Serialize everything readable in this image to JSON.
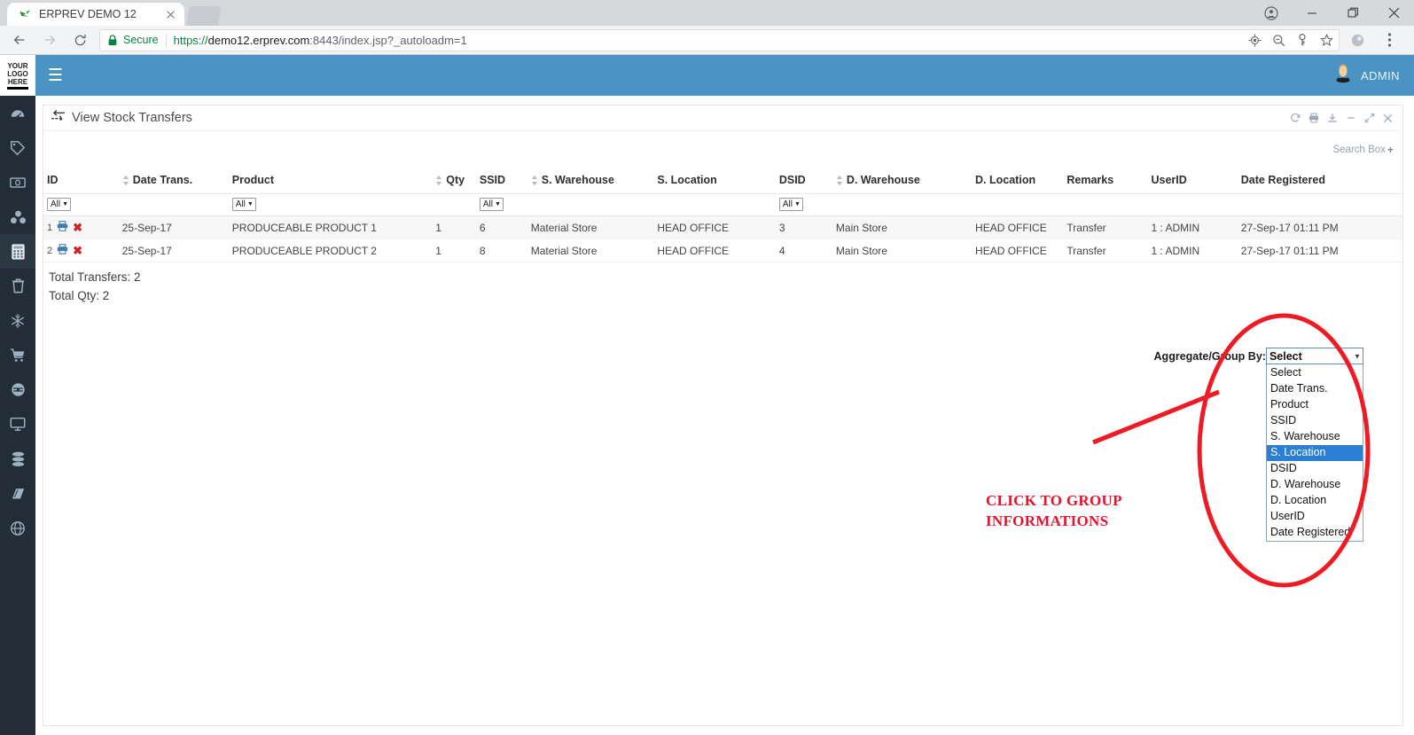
{
  "browser": {
    "tab": {
      "title": "ERPREV DEMO 12",
      "favicon_icon": "bird-logo-icon",
      "close_icon": "close-icon"
    },
    "new_tab_icon": "new-tab-icon",
    "window_controls": [
      {
        "name": "profile-icon",
        "glyph": "profile"
      },
      {
        "name": "minimize-button",
        "glyph": "minimize"
      },
      {
        "name": "maximize-button",
        "glyph": "maximize"
      },
      {
        "name": "close-window-button",
        "glyph": "close"
      }
    ],
    "nav": {
      "back_icon": "back-arrow-icon",
      "forward_icon": "forward-arrow-icon",
      "reload_icon": "reload-icon"
    },
    "omnibox": {
      "security_label": "Secure",
      "lock_icon": "lock-icon",
      "url_scheme": "https://",
      "url_host": "demo12.erprev.com",
      "url_rest": ":8443/index.jsp?_autoloadm=1",
      "full_url": "https://demo12.erprev.com:8443/index.jsp?_autoloadm=1",
      "icons": [
        "location-target-icon",
        "zoom-out-icon",
        "key-icon",
        "bookmark-star-icon"
      ]
    },
    "toolbar_right": [
      "browser-profile-avatar-icon",
      "chrome-menu-icon"
    ]
  },
  "sidebar": {
    "logo": {
      "line1": "YOUR",
      "line2": "LOGO",
      "line3": "HERE"
    },
    "items": [
      {
        "name": "dashboard",
        "icon": "gauge-icon",
        "active": false
      },
      {
        "name": "sales",
        "icon": "tag-icon",
        "active": false
      },
      {
        "name": "finance",
        "icon": "money-icon",
        "active": false
      },
      {
        "name": "inventory",
        "icon": "cubes-icon",
        "active": false
      },
      {
        "name": "stock",
        "icon": "calculator-icon",
        "active": true
      },
      {
        "name": "waste",
        "icon": "trash-icon",
        "active": false
      },
      {
        "name": "cold-storage",
        "icon": "snowflake-icon",
        "active": false
      },
      {
        "name": "purchase",
        "icon": "shopping-cart-icon",
        "active": false
      },
      {
        "name": "production",
        "icon": "disc-icon",
        "active": false
      },
      {
        "name": "pos",
        "icon": "monitor-icon",
        "active": false
      },
      {
        "name": "database",
        "icon": "database-icon",
        "active": false
      },
      {
        "name": "reports",
        "icon": "book-icon",
        "active": false
      },
      {
        "name": "settings",
        "icon": "globe-icon",
        "active": false
      }
    ]
  },
  "topbar": {
    "menu_toggle_icon": "hamburger-menu-icon",
    "user_icon": "user-avatar-icon",
    "user_label": "ADMIN",
    "background_color": "#4a94c4"
  },
  "panel": {
    "title": "View Stock Transfers",
    "title_icon": "exchange-arrows-icon",
    "tools": [
      {
        "name": "refresh-icon",
        "glyph": "refresh"
      },
      {
        "name": "print-icon",
        "glyph": "print"
      },
      {
        "name": "download-icon",
        "glyph": "download"
      },
      {
        "name": "minimize-panel-icon",
        "glyph": "minus"
      },
      {
        "name": "expand-panel-icon",
        "glyph": "expand"
      },
      {
        "name": "close-panel-icon",
        "glyph": "close"
      }
    ],
    "search_box_label": "Search Box",
    "search_box_plus": "+"
  },
  "table": {
    "columns": [
      {
        "label": "ID",
        "sortable": false,
        "filter": "All"
      },
      {
        "label": "Date Trans.",
        "sortable": true,
        "filter": null
      },
      {
        "label": "Product",
        "sortable": false,
        "filter": "All"
      },
      {
        "label": "Qty",
        "sortable": true,
        "filter": null
      },
      {
        "label": "SSID",
        "sortable": false,
        "filter": "All"
      },
      {
        "label": "S. Warehouse",
        "sortable": true,
        "filter": null
      },
      {
        "label": "S. Location",
        "sortable": false,
        "filter": null
      },
      {
        "label": "DSID",
        "sortable": false,
        "filter": "All"
      },
      {
        "label": "D. Warehouse",
        "sortable": true,
        "filter": null
      },
      {
        "label": "D. Location",
        "sortable": false,
        "filter": null
      },
      {
        "label": "Remarks",
        "sortable": false,
        "filter": null
      },
      {
        "label": "UserID",
        "sortable": false,
        "filter": null
      },
      {
        "label": "Date Registered",
        "sortable": false,
        "filter": null
      }
    ],
    "rows": [
      {
        "id": "1",
        "date_trans": "25-Sep-17",
        "product": "PRODUCEABLE PRODUCT 1",
        "qty": "1",
        "ssid": "6",
        "s_warehouse": "Material Store",
        "s_location": "HEAD OFFICE",
        "dsid": "3",
        "d_warehouse": "Main Store",
        "d_location": "HEAD OFFICE",
        "remarks": "Transfer",
        "userid": "1 : ADMIN",
        "date_registered": "27-Sep-17 01:11 PM"
      },
      {
        "id": "2",
        "date_trans": "25-Sep-17",
        "product": "PRODUCEABLE PRODUCT 2",
        "qty": "1",
        "ssid": "8",
        "s_warehouse": "Material Store",
        "s_location": "HEAD OFFICE",
        "dsid": "4",
        "d_warehouse": "Main Store",
        "d_location": "HEAD OFFICE",
        "remarks": "Transfer",
        "userid": "1 : ADMIN",
        "date_registered": "27-Sep-17 01:11 PM"
      }
    ],
    "row_print_icon": "print-row-icon",
    "row_delete_icon": "delete-row-icon",
    "totals": {
      "transfers": "Total Transfers: 2",
      "qty": "Total Qty: 2"
    }
  },
  "aggregate": {
    "label": "Aggregate/Group By:",
    "selected": "Select",
    "options": [
      "Select",
      "Date Trans.",
      "Product",
      "SSID",
      "S. Warehouse",
      "S. Location",
      "DSID",
      "D. Warehouse",
      "D. Location",
      "UserID",
      "Date Registered"
    ],
    "highlighted_option": "S. Location",
    "highlight_color": "#2a7fd4"
  },
  "annotation": {
    "line1": "CLICK TO GROUP",
    "line2": "INFORMATIONS",
    "color": "#e2142d",
    "shapes": [
      "ellipse-highlight",
      "pointer-line"
    ]
  }
}
